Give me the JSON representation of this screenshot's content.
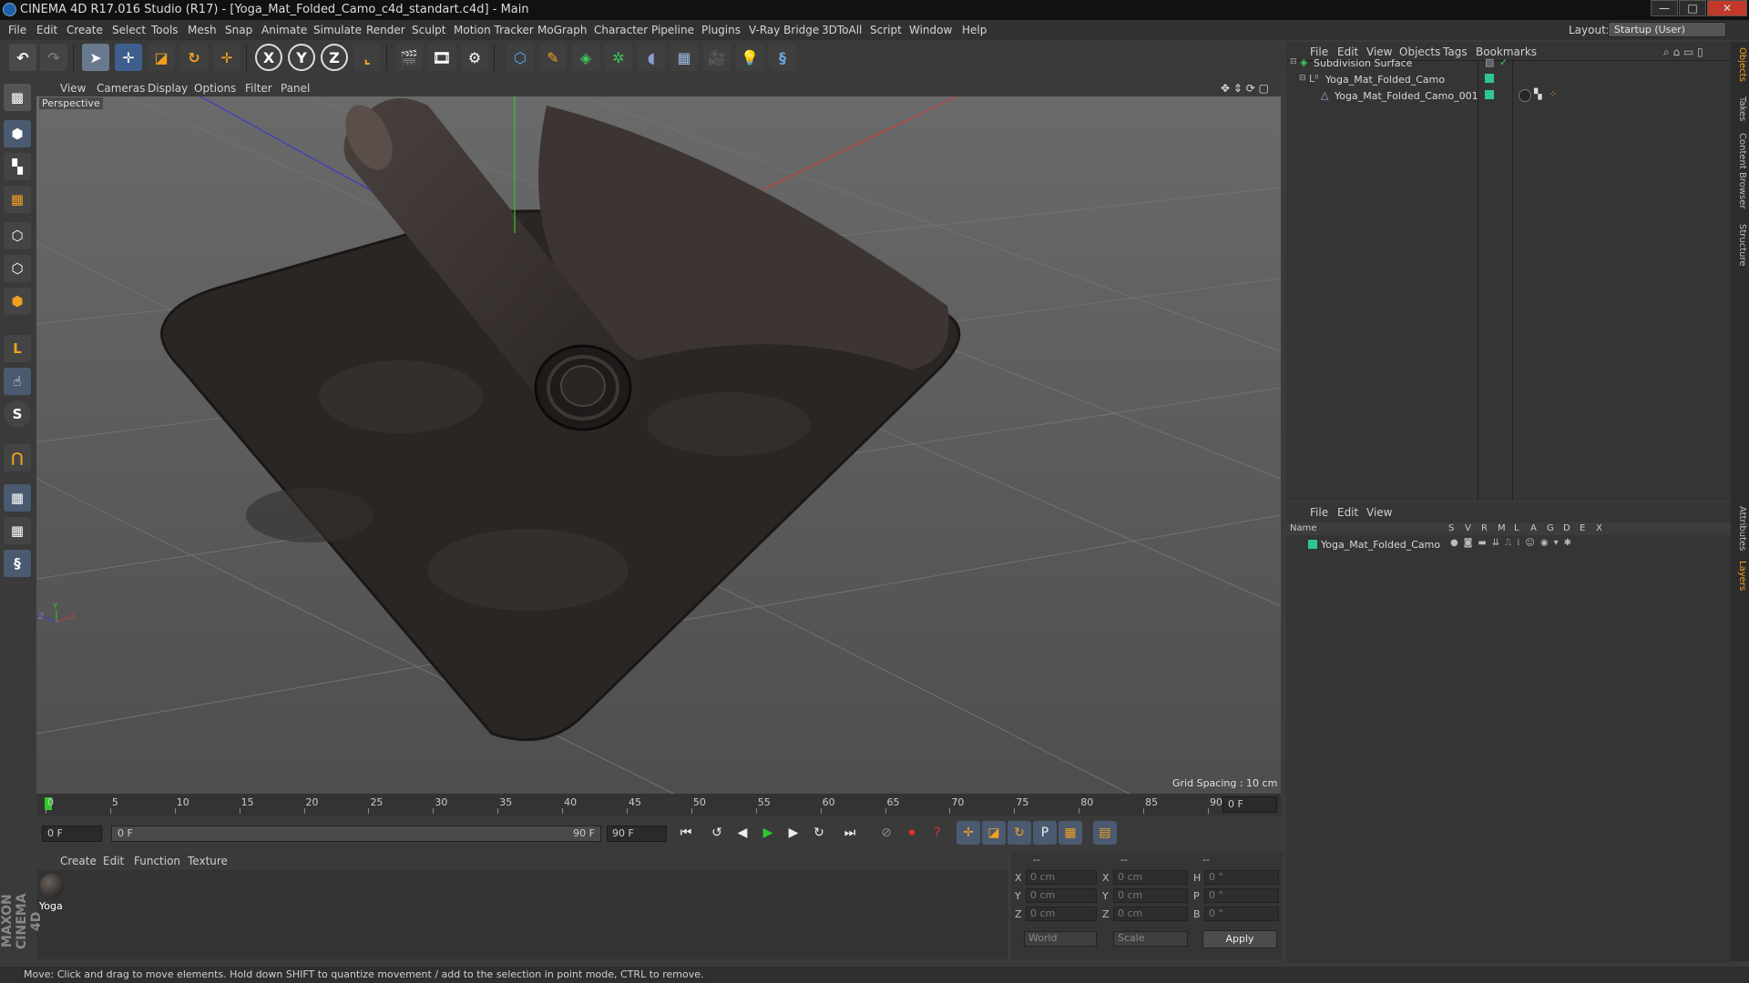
{
  "window": {
    "title": "CINEMA 4D R17.016 Studio (R17) - [Yoga_Mat_Folded_Camo_c4d_standart.c4d] - Main",
    "minimize": "—",
    "maximize": "□",
    "close": "✕"
  },
  "menu": [
    "File",
    "Edit",
    "Create",
    "Select",
    "Tools",
    "Mesh",
    "Snap",
    "Animate",
    "Simulate",
    "Render",
    "Sculpt",
    "Motion Tracker",
    "MoGraph",
    "Character",
    "Pipeline",
    "Plugins",
    "V-Ray Bridge",
    "3DToAll",
    "Script",
    "Window",
    "Help"
  ],
  "layout": {
    "label": "Layout:",
    "value": "Startup (User)"
  },
  "toolbar": {
    "icons": [
      "undo-icon",
      "redo-icon",
      "select-arrow-icon",
      "move-icon",
      "scale-icon",
      "rotate-icon",
      "add-icon",
      "x-axis-icon",
      "y-axis-icon",
      "z-axis-icon",
      "coordinate-system-icon",
      "render-view-icon",
      "render-picture-viewer-icon",
      "edit-render-settings-icon",
      "cube-icon",
      "pen-spline-icon",
      "subdivision-icon",
      "mograph-icon",
      "deformer-icon",
      "floor-icon",
      "camera-icon",
      "light-icon",
      "python-icon"
    ],
    "x_label": "X",
    "y_label": "Y",
    "z_label": "Z"
  },
  "left_toolbar": {
    "icons": [
      "make-editable-icon",
      "model-mode-icon",
      "texture-mode-icon",
      "workplane-icon",
      "points-mode-icon",
      "edges-mode-icon",
      "polygons-mode-icon",
      "axis-mode-icon",
      "tweak-icon",
      "snap-icon",
      "magnet-icon",
      "grid-lock-icon",
      "soft-select-icon",
      "python-script-icon"
    ],
    "s_label": "S",
    "l_label": "L"
  },
  "viewport": {
    "menu": [
      "View",
      "Cameras",
      "Display",
      "Options",
      "Filter",
      "Panel"
    ],
    "label": "Perspective",
    "grid_spacing": "Grid Spacing : 10 cm",
    "axis_x": "X",
    "axis_y": "Y",
    "axis_z": "Z",
    "colors": {
      "background": "#5c5c5c",
      "grid": "#6a6a6a",
      "mat": "#2b2726",
      "mat_light": "#4a413e",
      "x_axis": "#c83c3c",
      "y_axis": "#2ec82e",
      "z_axis": "#3c3cc8"
    }
  },
  "timeline": {
    "ticks": [
      "0",
      "5",
      "10",
      "15",
      "20",
      "25",
      "30",
      "35",
      "40",
      "45",
      "50",
      "55",
      "60",
      "65",
      "70",
      "75",
      "80",
      "85",
      "90"
    ],
    "current_frame": "0 F",
    "start_field": "0 F",
    "range_start": "0 F",
    "range_end": "90 F",
    "end_field": "90 F"
  },
  "transport": {
    "icons": [
      "go-to-start-icon",
      "previous-key-icon",
      "step-back-icon",
      "play-icon",
      "step-forward-icon",
      "next-key-icon",
      "go-to-end-icon",
      "record-off-icon",
      "record-icon",
      "autokey-icon",
      "move-key-icon",
      "scale-key-icon",
      "rotate-key-icon",
      "param-key-icon",
      "pla-key-icon",
      "timeline-icon"
    ],
    "param_label": "P"
  },
  "material": {
    "menu": [
      "Create",
      "Edit",
      "Function",
      "Texture"
    ],
    "items": [
      {
        "name": "Yoga"
      }
    ],
    "brand": "MAXON CINEMA 4D"
  },
  "coords": {
    "headers": [
      "--",
      "--",
      "--"
    ],
    "rows": [
      {
        "a": "X",
        "av": "0 cm",
        "b": "X",
        "bv": "0 cm",
        "c": "H",
        "cv": "0 °"
      },
      {
        "a": "Y",
        "av": "0 cm",
        "b": "Y",
        "bv": "0 cm",
        "c": "P",
        "cv": "0 °"
      },
      {
        "a": "Z",
        "av": "0 cm",
        "b": "Z",
        "bv": "0 cm",
        "c": "B",
        "cv": "0 °"
      }
    ],
    "world": "World",
    "scale": "Scale",
    "apply": "Apply"
  },
  "objects": {
    "menu": [
      "File",
      "Edit",
      "View",
      "Objects",
      "Tags",
      "Bookmarks"
    ],
    "rows": [
      {
        "name": "Subdivision Surface",
        "indent": 0
      },
      {
        "name": "Yoga_Mat_Folded_Camo",
        "indent": 1
      },
      {
        "name": "Yoga_Mat_Folded_Camo_001",
        "indent": 2
      }
    ]
  },
  "layers": {
    "menu": [
      "File",
      "Edit",
      "View"
    ],
    "header_name": "Name",
    "columns": [
      "S",
      "V",
      "R",
      "M",
      "L",
      "A",
      "G",
      "D",
      "E",
      "X"
    ],
    "rows": [
      {
        "name": "Yoga_Mat_Folded_Camo"
      }
    ]
  },
  "right_tabs": [
    "Objects",
    "Takes",
    "Content Browser",
    "Structure",
    "Attributes",
    "Layers"
  ],
  "status": "Move: Click and drag to move elements. Hold down SHIFT to quantize movement / add to the selection in point mode, CTRL to remove."
}
